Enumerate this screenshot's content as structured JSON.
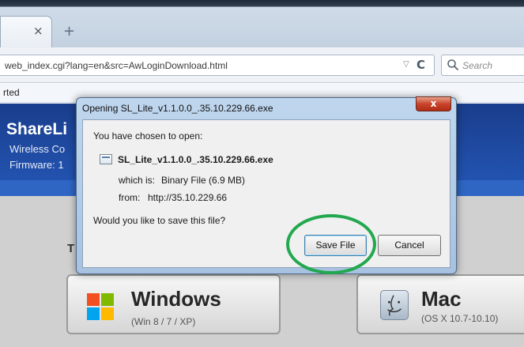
{
  "browser": {
    "tab_close": "×",
    "new_tab": "+",
    "url": "web_index.cgi?lang=en&src=AwLoginDownload.html",
    "url_dropdown": "▽",
    "reload": "C",
    "search_placeholder": "Search",
    "bookmark": "rted"
  },
  "page": {
    "brand": "ShareLi",
    "brand_sub": "Wireless Co",
    "firmware": "Firmware: 1",
    "heading_fragment": "T",
    "downloads": [
      {
        "title": "Windows",
        "subtitle": "(Win 8 / 7 / XP)"
      },
      {
        "title": "Mac",
        "subtitle": "(OS X 10.7-10.10)"
      }
    ],
    "colors": {
      "banner": "#1f4aa0",
      "highlight": "#22a84e"
    }
  },
  "dialog": {
    "title": "Opening SL_Lite_v1.1.0.0_.35.10.229.66.exe",
    "close": "x",
    "prompt": "You have chosen to open:",
    "filename": "SL_Lite_v1.1.0.0_.35.10.229.66.exe",
    "which_is_label": "which is:",
    "which_is_value": "Binary File (6.9 MB)",
    "from_label": "from:",
    "from_value": "http://35.10.229.66",
    "question": "Would you like to save this file?",
    "save_label": "Save File",
    "cancel_label": "Cancel"
  }
}
